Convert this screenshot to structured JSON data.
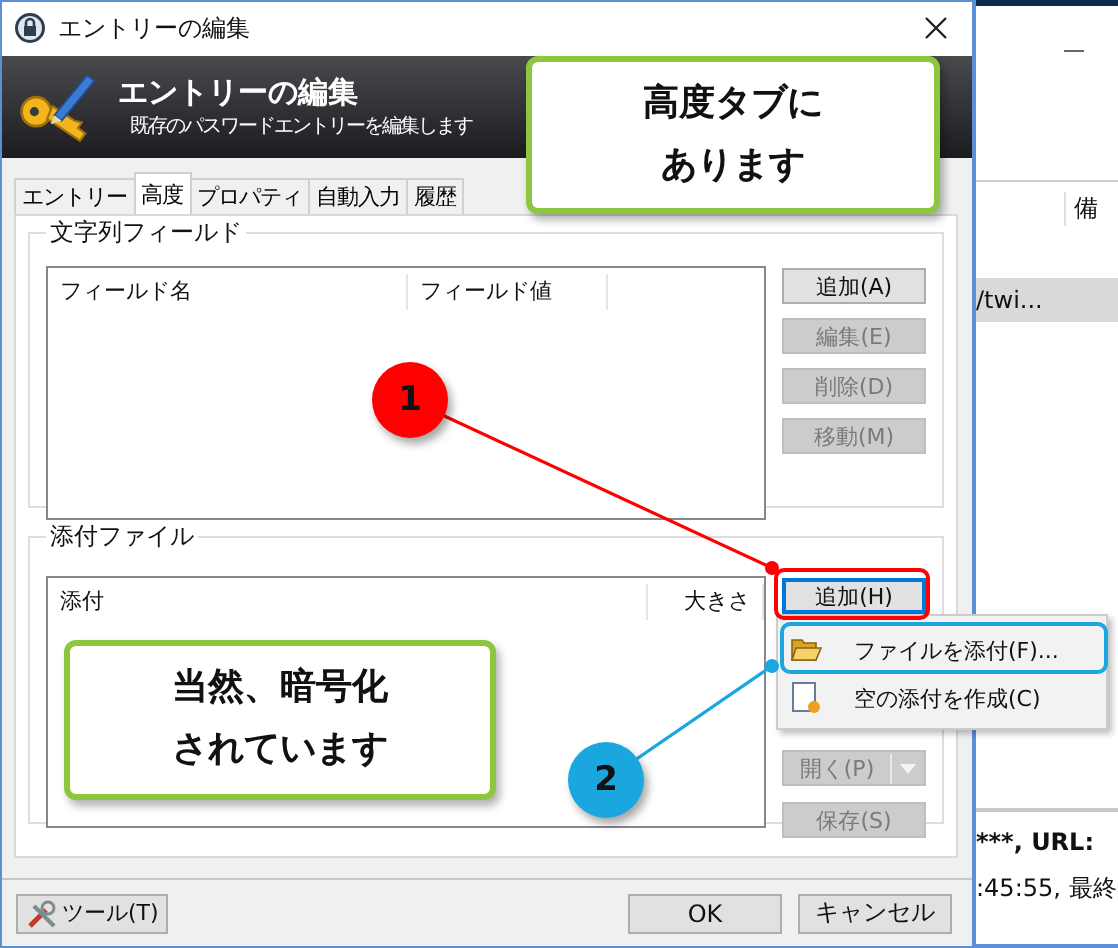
{
  "dialog": {
    "title": "エントリーの編集",
    "header": {
      "title": "エントリーの編集",
      "subtitle": "既存のパスワードエントリーを編集します"
    },
    "tabs": [
      {
        "label": "エントリー",
        "selected": false
      },
      {
        "label": "高度",
        "selected": true
      },
      {
        "label": "プロパティ",
        "selected": false
      },
      {
        "label": "自動入力",
        "selected": false
      },
      {
        "label": "履歴",
        "selected": false
      }
    ],
    "string_fields": {
      "title": "文字列フィールド",
      "columns": [
        "フィールド名",
        "フィールド値"
      ],
      "buttons": [
        {
          "label": "追加(A)",
          "disabled": false
        },
        {
          "label": "編集(E)",
          "disabled": true
        },
        {
          "label": "削除(D)",
          "disabled": true
        },
        {
          "label": "移動(M)",
          "disabled": true
        }
      ]
    },
    "attachments": {
      "title": "添付ファイル",
      "columns": [
        "添付",
        "大きさ"
      ],
      "add_button": {
        "label": "追加(H)",
        "disabled": false
      },
      "open_button": {
        "label": "開く(P)",
        "disabled": true
      },
      "save_button": {
        "label": "保存(S)",
        "disabled": true
      }
    },
    "context_menu": [
      {
        "label": "ファイルを添付(F)...",
        "kind": "folder"
      },
      {
        "label": "空の添付を作成(C)",
        "kind": "new"
      }
    ],
    "footer": {
      "tools_button": "ツール(T)",
      "ok_button": "OK",
      "cancel_button": "キャンセル"
    }
  },
  "background_window": {
    "column_header": "備",
    "row_cell": "/twi...",
    "status_lines": [
      "***, URL:",
      ":45:55, 最終"
    ]
  },
  "callouts": [
    {
      "lines": [
        "高度タブに",
        "あります"
      ]
    },
    {
      "lines": [
        "当然、暗号化",
        "されています"
      ]
    }
  ],
  "markers": [
    {
      "number": "1",
      "color": "#ff0000"
    },
    {
      "number": "2",
      "color": "#1aa7e0"
    }
  ]
}
